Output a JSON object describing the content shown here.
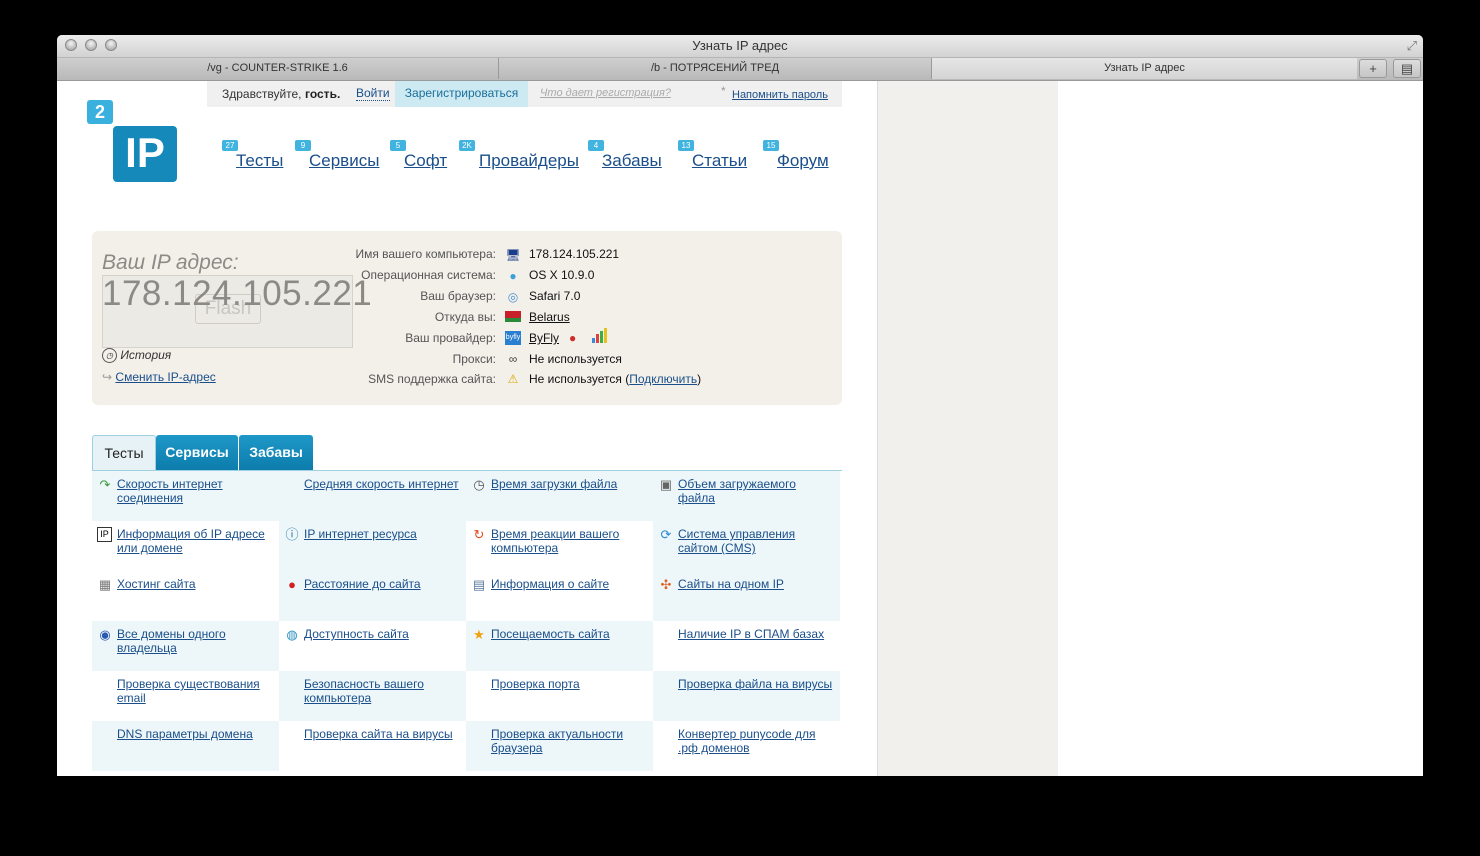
{
  "window": {
    "title": "Узнать IP адрес"
  },
  "browser_tabs": [
    {
      "label": "/vg - COUNTER-STRIKE 1.6"
    },
    {
      "label": "/b - ПОТРЯСЕНИЙ ТРЕД"
    },
    {
      "label": "Узнать IP адрес"
    }
  ],
  "userbar": {
    "greeting_prefix": "Здравствуйте,",
    "greeting_user": "гость.",
    "login": "Войти",
    "register": "Зарегистрироваться",
    "what_gives": "Что дает регистрация?",
    "asterisk": "*",
    "remind": "Напомнить пароль"
  },
  "logo": {
    "badge": "2",
    "text": "IP"
  },
  "nav": [
    {
      "label": "Тесты",
      "badge": "27"
    },
    {
      "label": "Сервисы",
      "badge": "9"
    },
    {
      "label": "Софт",
      "badge": "5"
    },
    {
      "label": "Провайдеры",
      "badge": "2K"
    },
    {
      "label": "Забавы",
      "badge": "4"
    },
    {
      "label": "Статьи",
      "badge": "13"
    },
    {
      "label": "Форум",
      "badge": "15"
    }
  ],
  "ip_panel": {
    "label": "Ваш IP адрес:",
    "ip": "178.124.105.221",
    "flash": "Flash",
    "history": "История",
    "change_ip": "Сменить IP-адрес",
    "rows": [
      {
        "label": "Имя вашего компьютера:",
        "value": "178.124.105.221",
        "icon": "computer-icon",
        "link": false
      },
      {
        "label": "Операционная система:",
        "value": "OS X 10.9.0",
        "icon": "apple-icon",
        "link": false
      },
      {
        "label": "Ваш браузер:",
        "value": "Safari 7.0",
        "icon": "safari-icon",
        "link": false
      },
      {
        "label": "Откуда вы:",
        "value": "Belarus",
        "icon": "flag-icon",
        "link": true
      },
      {
        "label": "Ваш провайдер:",
        "value": "ByFly",
        "icon": "byfly-icon",
        "link": true
      },
      {
        "label": "Прокси:",
        "value": "Не используется",
        "icon": "glasses-icon",
        "link": false
      },
      {
        "label": "SMS поддержка сайта:",
        "value": "Не используется (",
        "icon": "warning-icon",
        "link": false,
        "extra_link": "Подключить",
        "suffix": ")"
      }
    ]
  },
  "section_tabs": [
    "Тесты",
    "Сервисы",
    "Забавы"
  ],
  "tools": [
    {
      "label": "Скорость интернет соединения",
      "icon": "speed-arrow-icon"
    },
    {
      "label": "Средняя скорость интернет",
      "icon": ""
    },
    {
      "label": "Время загрузки файла",
      "icon": "clock-icon"
    },
    {
      "label": "Объем загружаемого файла",
      "icon": "file-size-icon"
    },
    {
      "label": "Информация об IP адресе или домене",
      "icon": "ip-info-icon"
    },
    {
      "label": "IP интернет ресурса",
      "icon": "ip-resource-icon"
    },
    {
      "label": "Время реакции вашего компьютера",
      "icon": "reaction-icon"
    },
    {
      "label": "Система управления сайтом (CMS)",
      "icon": "cms-icon"
    },
    {
      "label": "Хостинг сайта",
      "icon": "hosting-icon"
    },
    {
      "label": "Расстояние до сайта",
      "icon": "map-pin-icon"
    },
    {
      "label": "Информация о сайте",
      "icon": "document-icon"
    },
    {
      "label": "Сайты на одном IP",
      "icon": "network-icon"
    },
    {
      "label": "Все домены одного владельца",
      "icon": "owner-icon"
    },
    {
      "label": "Доступность сайта",
      "icon": "globe-icon"
    },
    {
      "label": "Посещаемость сайта",
      "icon": "star-icon"
    },
    {
      "label": "Наличие IP в СПАМ базах",
      "icon": ""
    },
    {
      "label": "Проверка существования email",
      "icon": ""
    },
    {
      "label": "Безопасность вашего компьютера",
      "icon": ""
    },
    {
      "label": "Проверка порта",
      "icon": ""
    },
    {
      "label": "Проверка файла на вирусы",
      "icon": ""
    },
    {
      "label": "DNS параметры домена",
      "icon": ""
    },
    {
      "label": "Проверка сайта на вирусы",
      "icon": ""
    },
    {
      "label": "Проверка актуальности браузера",
      "icon": ""
    },
    {
      "label": "Конвертер punycode для .рф доменов",
      "icon": ""
    }
  ]
}
